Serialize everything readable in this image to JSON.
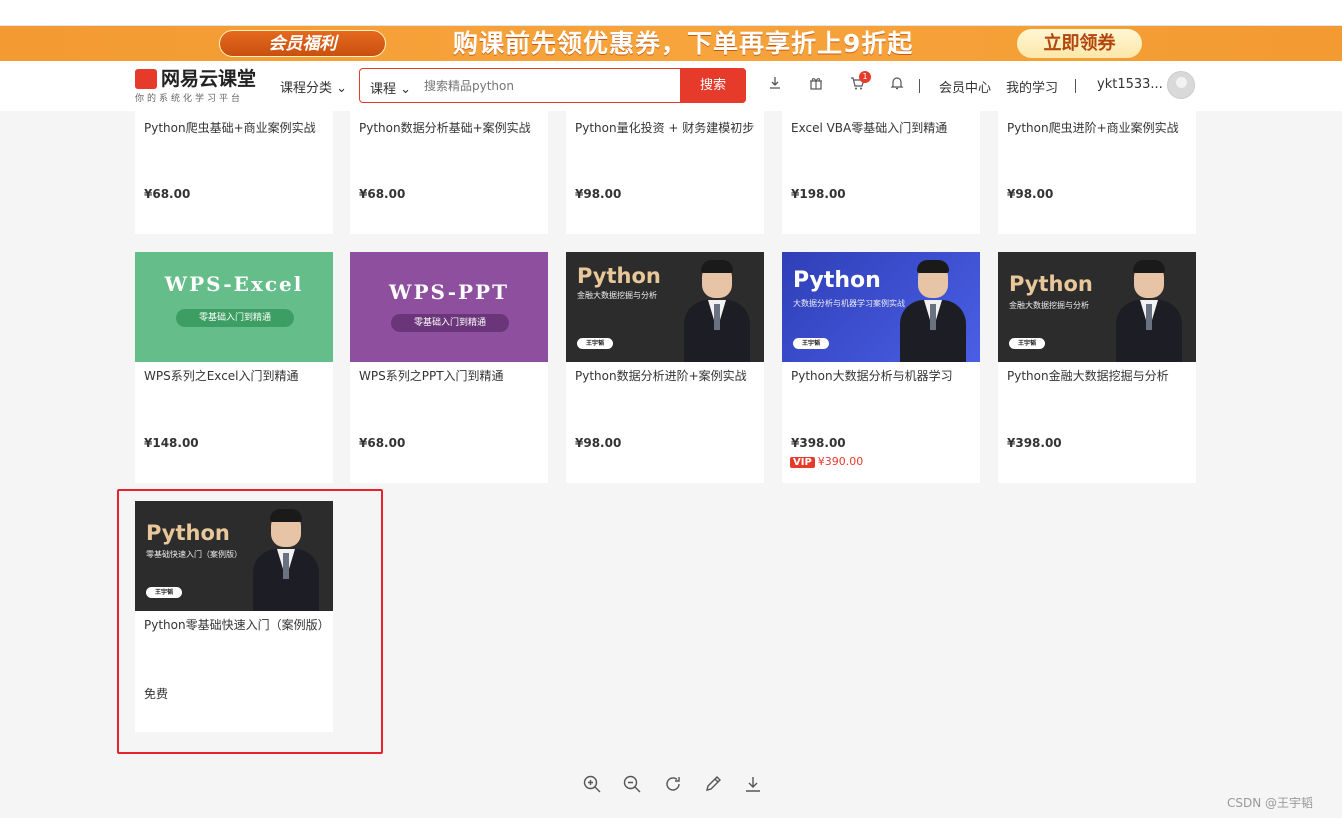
{
  "promo": {
    "vip_label": "会员福利",
    "headline": "购课前先领优惠券，下单再享折上9折起",
    "cta": "立即领券"
  },
  "header": {
    "logo_text": "网易云课堂",
    "logo_sub": "你的系统化学习平台",
    "category": "课程分类",
    "search_type": "课程",
    "search_placeholder": "搜索精品python",
    "search_button": "搜索",
    "cart_badge": "1",
    "member_center": "会员中心",
    "my_learning": "我的学习",
    "username": "ykt1533..."
  },
  "courses_row1": [
    {
      "title": "Python爬虫基础+商业案例实战",
      "price": "¥68.00"
    },
    {
      "title": "Python数据分析基础+案例实战",
      "price": "¥68.00"
    },
    {
      "title": "Python量化投资 + 财务建模初步",
      "price": "¥98.00"
    },
    {
      "title": "Excel VBA零基础入门到精通",
      "price": "¥198.00"
    },
    {
      "title": "Python爬虫进阶+商业案例实战",
      "price": "¥98.00"
    }
  ],
  "courses_row2": [
    {
      "title": "WPS系列之Excel入门到精通",
      "price": "¥148.00",
      "thumb_title": "WPS-Excel",
      "thumb_pill": "零基础入门到精通"
    },
    {
      "title": "WPS系列之PPT入门到精通",
      "price": "¥68.00",
      "thumb_title": "WPS-PPT",
      "thumb_pill": "零基础入门到精通"
    },
    {
      "title": "Python数据分析进阶+案例实战",
      "price": "¥98.00",
      "thumb_title": "Python",
      "thumb_sub": "金融大数据挖掘与分析",
      "thumb_name": "王宇韬"
    },
    {
      "title": "Python大数据分析与机器学习",
      "price": "¥398.00",
      "vip_label": "VIP",
      "vip_price": "¥390.00",
      "thumb_title": "Python",
      "thumb_sub": "大数据分析与机器学习案例实战",
      "thumb_name": "王宇韬"
    },
    {
      "title": "Python金融大数据挖掘与分析",
      "price": "¥398.00",
      "thumb_title": "Python",
      "thumb_sub": "金融大数据挖掘与分析",
      "thumb_name": "王宇韬"
    }
  ],
  "course_row3": {
    "title": "Python零基础快速入门（案例版）",
    "price": "免费",
    "thumb_title": "Python",
    "thumb_sub": "零基础快速入门（案例版）",
    "thumb_name": "王宇韬"
  },
  "watermark": "CSDN @王宇韬"
}
